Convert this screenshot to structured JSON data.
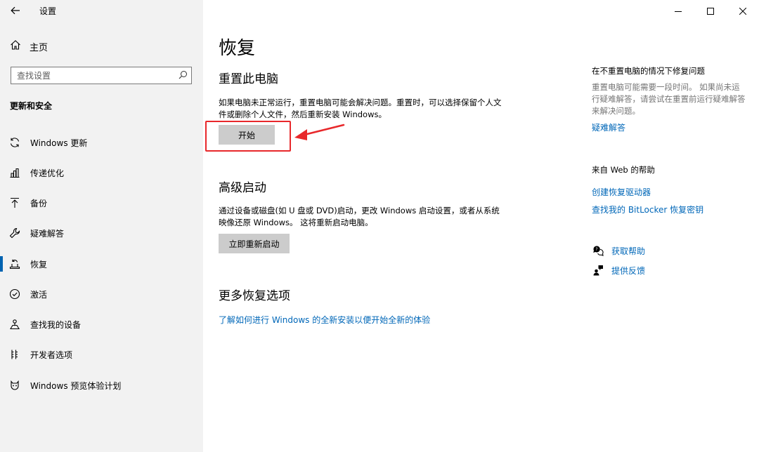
{
  "app": {
    "title": "设置"
  },
  "window_controls": {
    "minimize": "─",
    "maximize": "☐",
    "close": "✕"
  },
  "sidebar": {
    "home_label": "主页",
    "search_placeholder": "查找设置",
    "section_title": "更新和安全",
    "items": [
      {
        "label": "Windows 更新",
        "icon": "sync-icon",
        "selected": false
      },
      {
        "label": "传递优化",
        "icon": "delivery-optimization-icon",
        "selected": false
      },
      {
        "label": "备份",
        "icon": "backup-icon",
        "selected": false
      },
      {
        "label": "疑难解答",
        "icon": "wrench-icon",
        "selected": false
      },
      {
        "label": "恢复",
        "icon": "recovery-icon",
        "selected": true
      },
      {
        "label": "激活",
        "icon": "activation-icon",
        "selected": false
      },
      {
        "label": "查找我的设备",
        "icon": "find-device-icon",
        "selected": false
      },
      {
        "label": "开发者选项",
        "icon": "developer-icon",
        "selected": false
      },
      {
        "label": "Windows 预览体验计划",
        "icon": "insider-icon",
        "selected": false
      }
    ]
  },
  "main": {
    "title": "恢复",
    "reset": {
      "heading": "重置此电脑",
      "description": "如果电脑未正常运行，重置电脑可能会解决问题。重置时，可以选择保留个人文件或删除个人文件，然后重新安装 Windows。",
      "button": "开始"
    },
    "advanced": {
      "heading": "高级启动",
      "description": "通过设备或磁盘(如 U 盘或 DVD)启动，更改 Windows 启动设置，或者从系统映像还原 Windows。 这将重新启动电脑。",
      "button": "立即重新启动"
    },
    "more": {
      "heading": "更多恢复选项",
      "link": "了解如何进行 Windows 的全新安装以便开始全新的体验"
    }
  },
  "right_panel": {
    "fix_title": "在不重置电脑的情况下修复问题",
    "fix_text": "重置电脑可能需要一段时间。 如果尚未运行疑难解答，请尝试在重置前运行疑难解答来解决问题。",
    "fix_link": "疑难解答",
    "web_title": "来自 Web 的帮助",
    "web_links": [
      "创建恢复驱动器",
      "查找我的 BitLocker 恢复密钥"
    ],
    "actions": [
      {
        "label": "获取帮助",
        "icon": "help-chat-icon"
      },
      {
        "label": "提供反馈",
        "icon": "feedback-icon"
      }
    ]
  },
  "colors": {
    "accent": "#0063b1",
    "link": "#0067b8",
    "annotation": "#e8282b",
    "sidebar_bg": "#f2f2f2",
    "button_bg": "#cccccc"
  }
}
